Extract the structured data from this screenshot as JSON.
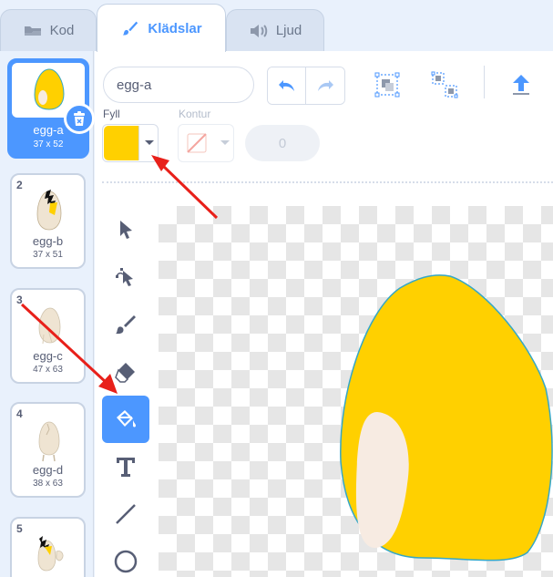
{
  "tabs": [
    {
      "label": "Kod",
      "icon": "code-icon"
    },
    {
      "label": "Klädslar",
      "icon": "brush-icon",
      "active": true
    },
    {
      "label": "Ljud",
      "icon": "speaker-icon"
    }
  ],
  "costumes": [
    {
      "number": "1",
      "name": "egg-a",
      "size": "37 x 52",
      "selected": true
    },
    {
      "number": "2",
      "name": "egg-b",
      "size": "37 x 51"
    },
    {
      "number": "3",
      "name": "egg-c",
      "size": "47 x 63"
    },
    {
      "number": "4",
      "name": "egg-d",
      "size": "38 x 63"
    },
    {
      "number": "5",
      "name": "",
      "size": ""
    }
  ],
  "editor": {
    "costume_name": "egg-a",
    "fill_label": "Fyll",
    "outline_label": "Kontur",
    "stroke_width": "0",
    "fill_color": "#ffd000"
  },
  "colors": {
    "accent": "#4c97ff",
    "egg_fill": "#ffd000",
    "egg_outline": "#35a7c6",
    "egg_highlight": "#f7ebe2",
    "annotation_arrow": "#e8201a"
  }
}
